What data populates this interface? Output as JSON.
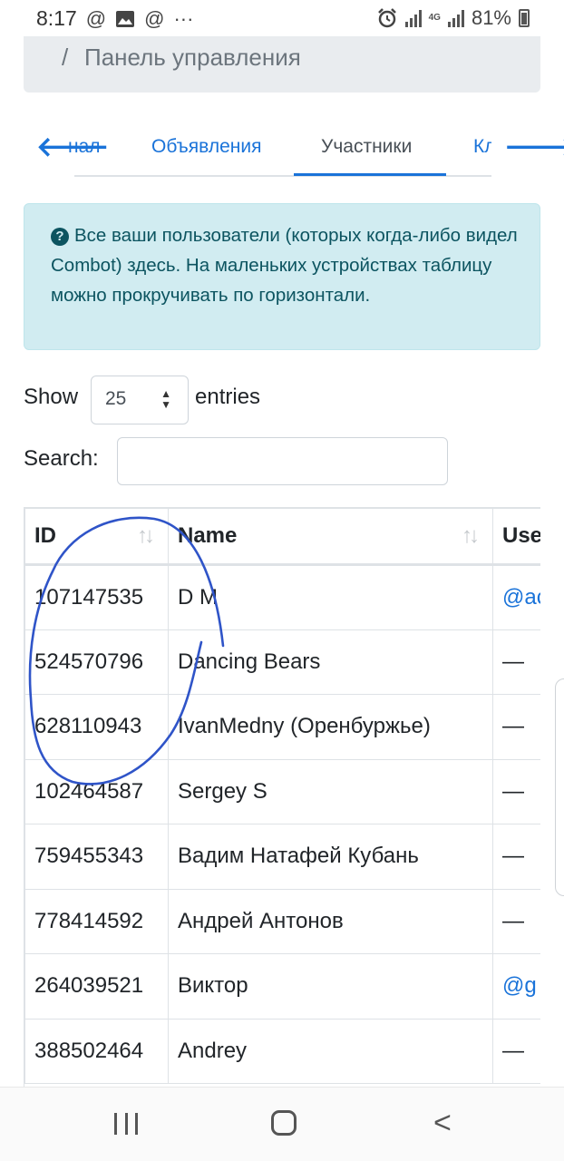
{
  "status_bar": {
    "time": "8:17",
    "left_icons": [
      "at-icon",
      "image-icon",
      "at-icon",
      "more-icon"
    ],
    "network_label": "4G",
    "battery": "81%"
  },
  "breadcrumb": {
    "separator": "/",
    "current": "Панель управления"
  },
  "tabs": {
    "items": [
      {
        "label": "Канал",
        "visible_label": "нал"
      },
      {
        "label": "Объявления"
      },
      {
        "label": "Участники",
        "active": true
      },
      {
        "label": "Кл"
      }
    ]
  },
  "alert": {
    "text": "Все ваши пользователи (которых когда-либо видел Combot) здесь. На маленьких устройствах таблицу можно прокручивать по горизонтали."
  },
  "length": {
    "show_label": "Show",
    "value": "25",
    "entries_label": "entries"
  },
  "search": {
    "label": "Search:",
    "value": ""
  },
  "table": {
    "columns": [
      "ID",
      "Name",
      "Use"
    ],
    "rows": [
      {
        "id": "107147535",
        "name": "D M",
        "user": "@ac",
        "user_is_link": true
      },
      {
        "id": "524570796",
        "name": "Dancing Bears",
        "user": "—",
        "user_is_link": false
      },
      {
        "id": "628110943",
        "name": "IvanMedny (Оренбуржье)",
        "user": "—",
        "user_is_link": false
      },
      {
        "id": "102464587",
        "name": "Sergey S",
        "user": "—",
        "user_is_link": false
      },
      {
        "id": "759455343",
        "name": "Вадим Натафей Кубань",
        "user": "—",
        "user_is_link": false
      },
      {
        "id": "778414592",
        "name": "Андрей Антонов",
        "user": "—",
        "user_is_link": false
      },
      {
        "id": "264039521",
        "name": "Виктор",
        "user": "@g",
        "user_is_link": true
      },
      {
        "id": "388502464",
        "name": "Andrey",
        "user": "—",
        "user_is_link": false
      }
    ]
  },
  "colors": {
    "link": "#1a73d9",
    "alert_bg": "#d1ecf1",
    "alert_text": "#0c5460",
    "annotation": "#2f54c8"
  }
}
